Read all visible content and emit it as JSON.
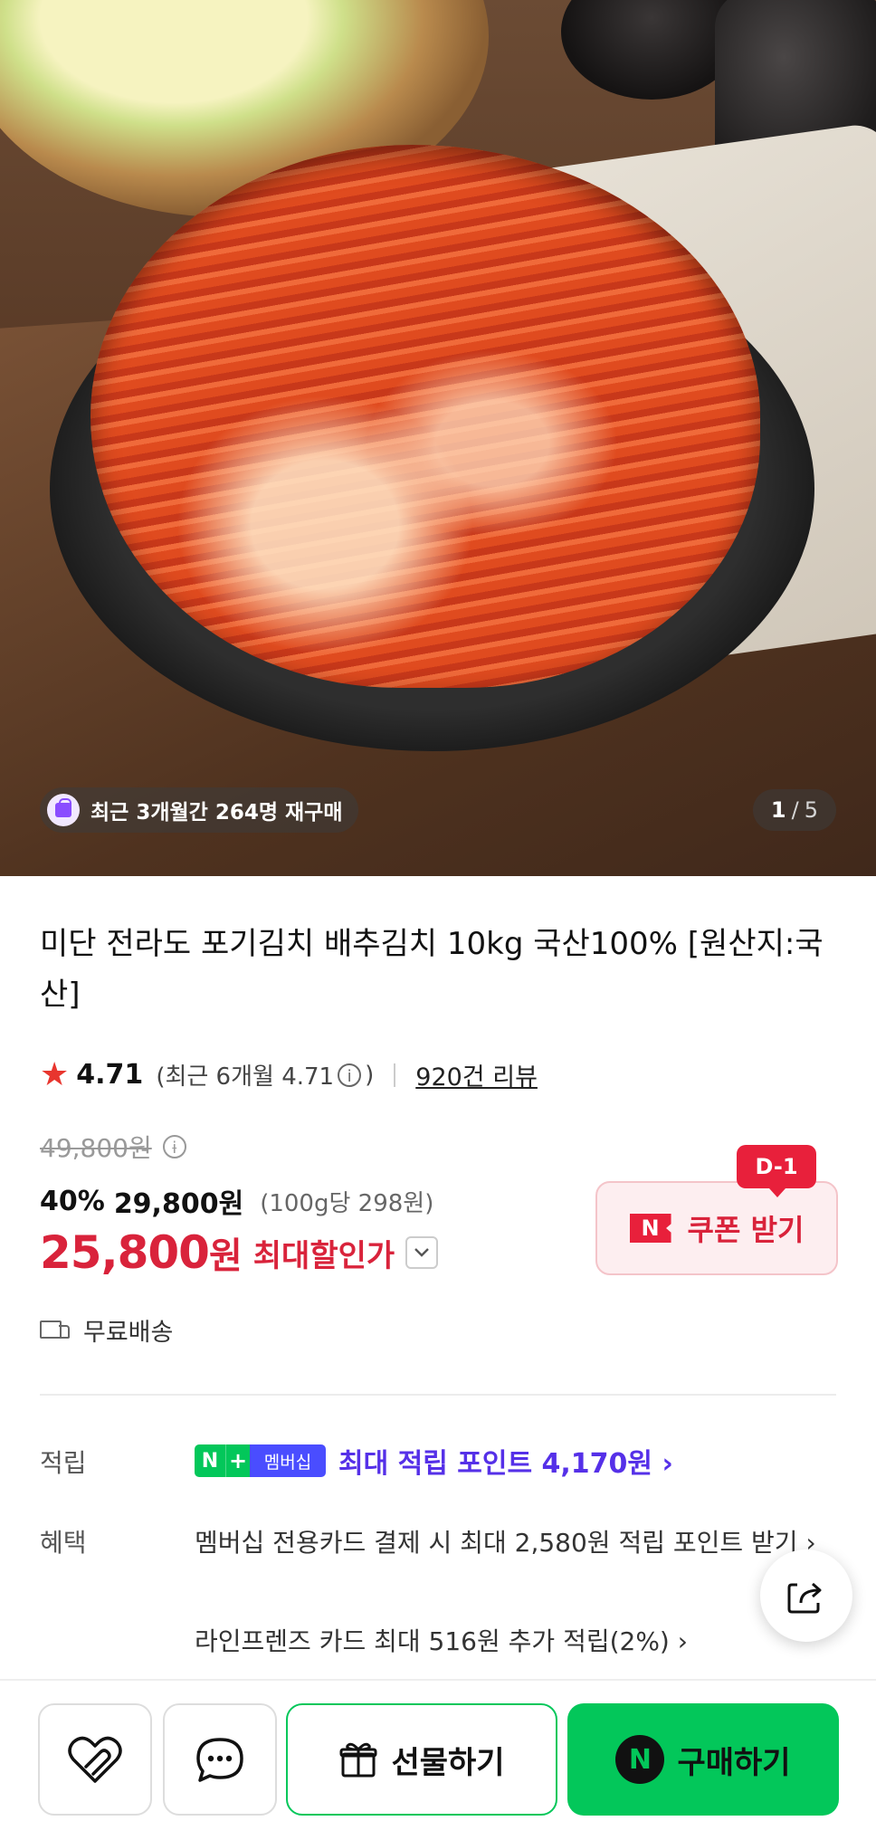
{
  "hero": {
    "repurchase_text": "최근 3개월간 264명 재구매",
    "pager_current": "1",
    "pager_sep": "/",
    "pager_total": "5"
  },
  "product": {
    "title": "미단 전라도 포기김치 배추김치 10kg 국산100% [원산지:국산]",
    "rating_score": "4.71",
    "rating_recent_prefix": "(최근 6개월 4.71",
    "rating_recent_suffix": ")",
    "reviews": "920건 리뷰",
    "original_price": "49,800원",
    "discount_rate": "40%",
    "sale_price": "29,800원",
    "unit_price": "(100g당 298원)",
    "best_price_num": "25,800",
    "best_price_won": "원",
    "best_price_label": "최대할인가",
    "shipping": "무료배송"
  },
  "coupon": {
    "dday": "D-1",
    "logo": "N",
    "label": "쿠폰 받기"
  },
  "benefits": {
    "points_label": "적립",
    "badge_n": "N",
    "badge_plus": "+",
    "badge_membership": "멤버십",
    "points_text": "최대 적립 포인트 4,170원 ›",
    "benefit_label": "혜택",
    "benefit1": "멤버십 전용카드 결제 시 최대 2,580원 적립 포인트 받기 ›",
    "benefit2": "라인프렌즈 카드 최대 516원 추가 적립(2%) ›"
  },
  "bottom_bar": {
    "gift_label": "선물하기",
    "buy_logo": "N",
    "buy_label": "구매하기"
  },
  "colors": {
    "accent_red": "#d9233b",
    "naver_green": "#03c75a",
    "points_purple": "#5530e8"
  }
}
